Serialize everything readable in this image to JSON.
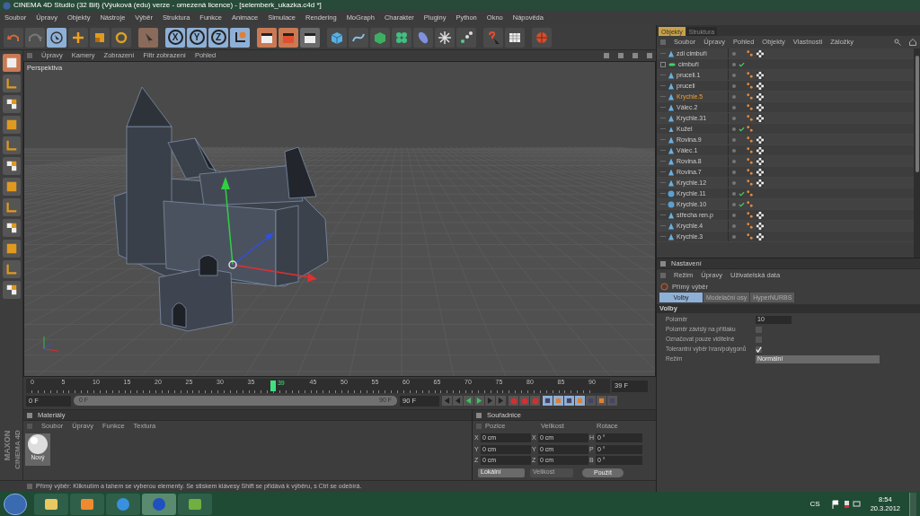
{
  "window": {
    "title": "CINEMA 4D Studio (32 Bit) (Výuková (edu) verze - omezená licence) - [selemberk_ukazka.c4d *]"
  },
  "menu": [
    "Soubor",
    "Úpravy",
    "Objekty",
    "Nástroje",
    "Výběr",
    "Struktura",
    "Funkce",
    "Animace",
    "Simulace",
    "Rendering",
    "MoGraph",
    "Charakter",
    "Pluginy",
    "Python",
    "Okno",
    "Nápověda"
  ],
  "toolbar": {
    "axis_buttons": [
      "X",
      "Y",
      "Z"
    ]
  },
  "viewport": {
    "menu": [
      "Úpravy",
      "Kamery",
      "Zobrazení",
      "Filtr zobrazení",
      "Pohled"
    ],
    "camera": "Perspektiva"
  },
  "timeline": {
    "ticks_before": [
      "0",
      "5",
      "10",
      "15",
      "20",
      "25",
      "30",
      "35"
    ],
    "ticks_after": [
      "45",
      "50",
      "55",
      "60",
      "65",
      "70",
      "75",
      "80",
      "85",
      "90"
    ],
    "level": 0.433,
    "marker_label": "39",
    "current": "39 F",
    "start": "0 F",
    "range": {
      "start": "0 F",
      "end": "90 F",
      "level": 1
    },
    "end": "90 F"
  },
  "materials": {
    "title": "Materiály",
    "menu": [
      "Soubor",
      "Úpravy",
      "Funkce",
      "Textura"
    ],
    "items": [
      {
        "name": "Nový"
      }
    ]
  },
  "coordinates": {
    "title": "Souřadnice",
    "headers": [
      "Pozice",
      "Velikost",
      "Rotace"
    ],
    "rows": [
      {
        "pos_axis": "X",
        "pos": "0 cm",
        "size_axis": "X",
        "size": "0 cm",
        "rot_axis": "H",
        "rot": "0 °"
      },
      {
        "pos_axis": "Y",
        "pos": "0 cm",
        "size_axis": "Y",
        "size": "0 cm",
        "rot_axis": "P",
        "rot": "0 °"
      },
      {
        "pos_axis": "Z",
        "pos": "0 cm",
        "size_axis": "Z",
        "size": "0 cm",
        "rot_axis": "B",
        "rot": "0 °"
      }
    ],
    "mode": "Lokální",
    "size_mode": "Velikost",
    "apply": "Použít"
  },
  "brand": {
    "line1": "MAXON",
    "line2": "CINEMA 4D"
  },
  "status_bar": "Přímý výběr: Kliknutím a tahem se vyberou elementy. Se stiskem klávesy Shift se přidává k výběru, s Ctrl se odebírá.",
  "objects_panel": {
    "tabs": [
      {
        "label": "Objekty",
        "selected": true
      },
      {
        "label": "Struktura",
        "selected": false
      }
    ],
    "menu": [
      "Soubor",
      "Úpravy",
      "Pohled",
      "Objekty",
      "Vlastnosti",
      "Záložky"
    ],
    "objects": [
      {
        "name": "zdi cimbuří",
        "kind": "polygon",
        "selected": false,
        "check": false,
        "material": true,
        "texture": true
      },
      {
        "name": "cimbuří",
        "kind": "group",
        "selected": false,
        "check": true,
        "material": false,
        "texture": false
      },
      {
        "name": "pruceli.1",
        "kind": "polygon",
        "selected": false,
        "check": false,
        "material": true,
        "texture": true
      },
      {
        "name": "pruceli",
        "kind": "polygon",
        "selected": false,
        "check": false,
        "material": true,
        "texture": true
      },
      {
        "name": "Krychle.5",
        "kind": "polygon",
        "selected": true,
        "check": false,
        "material": true,
        "texture": true
      },
      {
        "name": "Válec.2",
        "kind": "polygon",
        "selected": false,
        "check": false,
        "material": true,
        "texture": true
      },
      {
        "name": "Krychle.31",
        "kind": "polygon",
        "selected": false,
        "check": false,
        "material": true,
        "texture": true
      },
      {
        "name": "Kužel",
        "kind": "cone",
        "selected": false,
        "check": true,
        "material": true,
        "texture": false
      },
      {
        "name": "Rovina.9",
        "kind": "polygon",
        "selected": false,
        "check": false,
        "material": true,
        "texture": true
      },
      {
        "name": "Válec.1",
        "kind": "polygon",
        "selected": false,
        "check": false,
        "material": true,
        "texture": true
      },
      {
        "name": "Rovina.8",
        "kind": "polygon",
        "selected": false,
        "check": false,
        "material": true,
        "texture": true
      },
      {
        "name": "Rovina.7",
        "kind": "polygon",
        "selected": false,
        "check": false,
        "material": true,
        "texture": true
      },
      {
        "name": "Krychle.12",
        "kind": "polygon",
        "selected": false,
        "check": false,
        "material": true,
        "texture": true
      },
      {
        "name": "Krychle.11",
        "kind": "primitive",
        "selected": false,
        "check": true,
        "material": true,
        "texture": false
      },
      {
        "name": "Krychle.10",
        "kind": "primitive",
        "selected": false,
        "check": true,
        "material": true,
        "texture": false
      },
      {
        "name": "střecha ren.p",
        "kind": "polygon",
        "selected": false,
        "check": false,
        "material": true,
        "texture": true
      },
      {
        "name": "Krychle.4",
        "kind": "polygon",
        "selected": false,
        "check": false,
        "material": true,
        "texture": true
      },
      {
        "name": "Krychle.3",
        "kind": "polygon",
        "selected": false,
        "check": false,
        "material": true,
        "texture": true
      }
    ]
  },
  "attributes": {
    "title": "Nastavení",
    "menu": [
      "Režim",
      "Úpravy",
      "Uživatelská data"
    ],
    "tool": "Přímý výběr",
    "tabs": [
      {
        "label": "Volby",
        "selected": true
      },
      {
        "label": "Modelační osy",
        "selected": false
      },
      {
        "label": "HyperNURBS",
        "selected": false
      }
    ],
    "section": "Volby",
    "fields": [
      {
        "kind": "number",
        "label": "Poloměr",
        "value": "10"
      },
      {
        "kind": "checkbox",
        "label": "Poloměr závislý na přítlaku",
        "checked": false
      },
      {
        "kind": "checkbox",
        "label": "Označovat pouze viditelné",
        "checked": false
      },
      {
        "kind": "checkbox",
        "label": "Tolerantní výběr hran/polygonů",
        "checked": true
      },
      {
        "kind": "dropdown",
        "label": "Režim",
        "value": "Normální"
      }
    ]
  },
  "taskbar": {
    "language": "CS",
    "time": "8:54",
    "date": "20.3.2012"
  }
}
